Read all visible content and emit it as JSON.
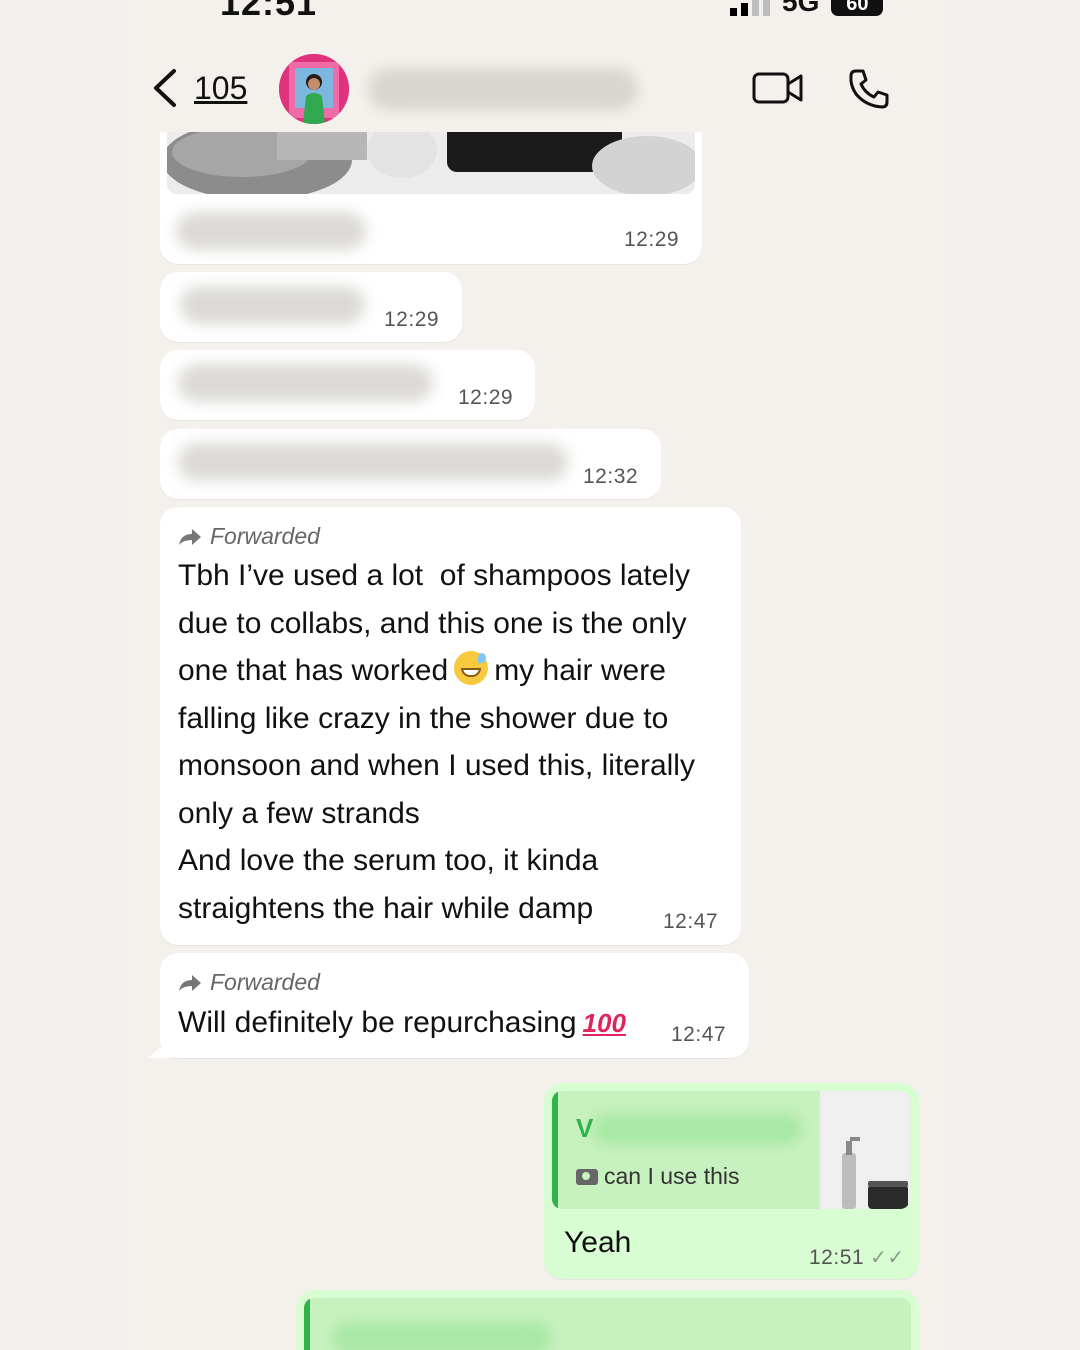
{
  "status": {
    "time": "12:51",
    "network": "5G",
    "battery": "60"
  },
  "header": {
    "back_count": "105"
  },
  "messages": {
    "m1": {
      "time": "12:29"
    },
    "m2": {
      "time": "12:29"
    },
    "m3": {
      "time": "12:29"
    },
    "m4": {
      "time": "12:32"
    },
    "m5": {
      "forwarded": "Forwarded",
      "line1": "Tbh I’ve used a lot  of shampoos lately",
      "line2": "due to collabs, and this one is the only",
      "line3a": "one that has worked",
      "line3b": "my hair were",
      "line4": "falling like crazy in the shower due to",
      "line5": "monsoon and when I used this, literally",
      "line6": "only a few strands",
      "line7": "And love the serum too, it kinda",
      "line8": "straightens the hair while damp",
      "time": "12:47"
    },
    "m6": {
      "forwarded": "Forwarded",
      "text": "Will definitely be repurchasing",
      "emoji": "100",
      "time": "12:47"
    },
    "m7": {
      "quote_initial": "V",
      "quote_text": "can I use this",
      "text": "Yeah",
      "time": "12:51"
    }
  },
  "icons": [
    "chevron-left-icon",
    "video-camera-icon",
    "phone-icon",
    "forward-arrow-icon",
    "camera-icon",
    "double-check-icon"
  ]
}
